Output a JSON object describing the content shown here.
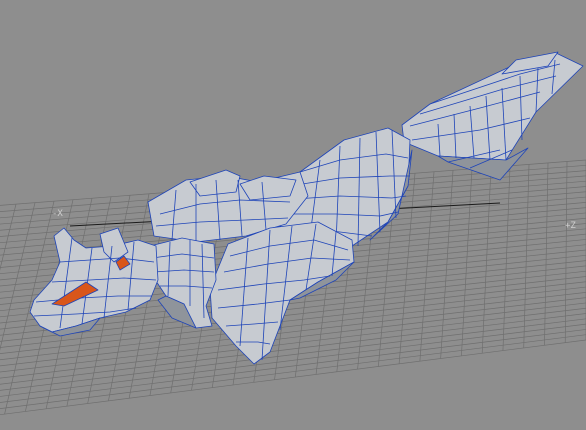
{
  "viewport": {
    "background_color": "#8e8e8e",
    "grid_color": "#6f6f6f",
    "axis_line_color": "#1a1a1a",
    "axis_labels": {
      "x_negative": "-X",
      "z_positive": "+Z"
    }
  },
  "model": {
    "kind": "wireframe-mesh",
    "subject": "fox",
    "shading": "flat-shaded",
    "surface_color": "#c7cbd1",
    "shadow_color": "#8f949b",
    "wire_color": "#1e44b8",
    "eye_color": "#d9561a"
  }
}
